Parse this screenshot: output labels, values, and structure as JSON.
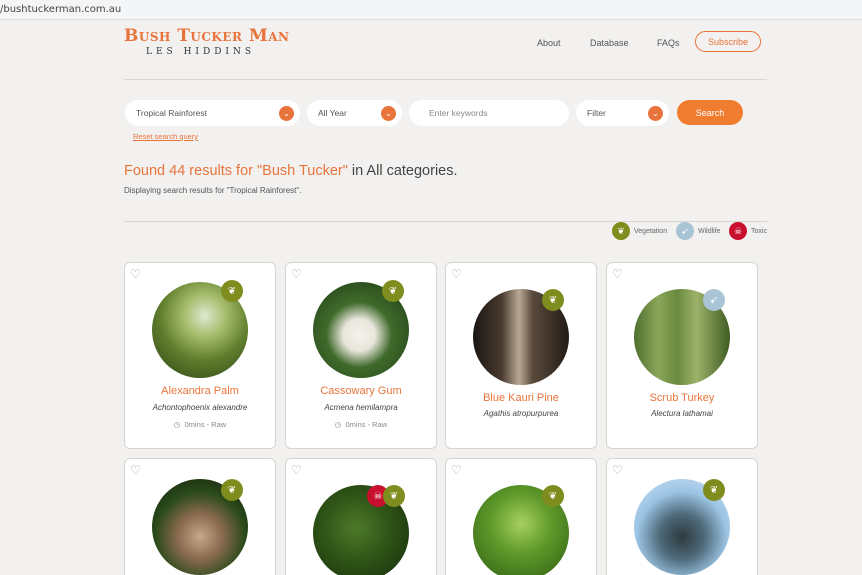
{
  "browser": {
    "url": "/bushtuckerman.com.au"
  },
  "header": {
    "logo_title": "Bush Tucker Man",
    "logo_subtitle": "LES HIDDINS",
    "nav": [
      "About",
      "Database",
      "FAQs"
    ],
    "subscribe_label": "Subscribe"
  },
  "search": {
    "region_value": "Tropical Rainforest",
    "season_value": "All Year",
    "keywords_placeholder": "Enter keywords",
    "filter_value": "Filter",
    "search_label": "Search",
    "reset_label": "Reset search query"
  },
  "results": {
    "prefix": "Found 44 results for ",
    "query": "\"Bush Tucker\"",
    "suffix": " in All categories.",
    "note": "Displaying search results for \"Tropical Rainforest\"."
  },
  "legend": [
    {
      "label": "Vegetation",
      "icon": "leaf-icon",
      "color": "#7f8c1e"
    },
    {
      "label": "Wildlife",
      "icon": "bird-icon",
      "color": "#a9c4d4"
    },
    {
      "label": "Toxic",
      "icon": "skull-icon",
      "color": "#c8102e"
    }
  ],
  "cards": [
    {
      "name": "Alexandra Palm",
      "scientific": "Achontophoenix alexandre",
      "meta": "0mins - Raw",
      "category": "vegetation"
    },
    {
      "name": "Cassowary Gum",
      "scientific": "Acmena hemilampra",
      "meta": "0mins - Raw",
      "category": "vegetation"
    },
    {
      "name": "Blue Kauri Pine",
      "scientific": "Agathis atropurpurea",
      "category": "vegetation"
    },
    {
      "name": "Scrub Turkey",
      "scientific": "Alectura lathamai",
      "category": "wildlife"
    },
    {
      "category": "vegetation"
    },
    {
      "category": "vegetation-toxic"
    },
    {
      "category": "vegetation"
    },
    {
      "category": "vegetation"
    }
  ],
  "colors": {
    "accent": "#e8743b",
    "vegetation": "#7f8c1e",
    "wildlife": "#a9c4d4",
    "toxic": "#c8102e"
  }
}
